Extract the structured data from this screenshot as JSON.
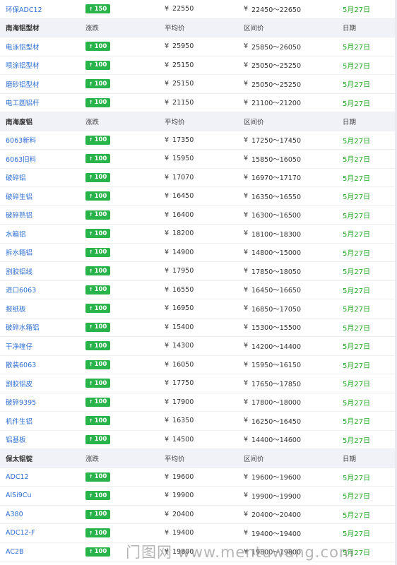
{
  "currency": "¥",
  "up_arrow": "↑",
  "watermark": "门图网 www.mentuwang.com",
  "sections": [
    {
      "header": null,
      "rows": [
        {
          "name": "环保ADC12",
          "change": "150",
          "avg": "22550",
          "range": "22450～22650",
          "date": "5月27日"
        }
      ]
    },
    {
      "header": {
        "name": "南海铝型材",
        "change": "涨跌",
        "avg": "平均价",
        "range": "区间价",
        "date": "日期"
      },
      "rows": [
        {
          "name": "电泳铝型材",
          "change": "100",
          "avg": "25950",
          "range": "25850～26050",
          "date": "5月27日"
        },
        {
          "name": "喷涂铝型材",
          "change": "100",
          "avg": "25150",
          "range": "25050～25250",
          "date": "5月27日"
        },
        {
          "name": "磨砂铝型材",
          "change": "100",
          "avg": "25150",
          "range": "25050～25250",
          "date": "5月27日"
        },
        {
          "name": "电工圆铝杆",
          "change": "100",
          "avg": "21150",
          "range": "21100～21200",
          "date": "5月27日"
        }
      ]
    },
    {
      "header": {
        "name": "南海废铝",
        "change": "涨跌",
        "avg": "平均价",
        "range": "区间价",
        "date": "日期"
      },
      "rows": [
        {
          "name": "6063新料",
          "change": "100",
          "avg": "17350",
          "range": "17250～17450",
          "date": "5月27日"
        },
        {
          "name": "6063旧料",
          "change": "100",
          "avg": "15950",
          "range": "15850～16050",
          "date": "5月27日"
        },
        {
          "name": "破碎铝",
          "change": "100",
          "avg": "17070",
          "range": "16970～17170",
          "date": "5月27日"
        },
        {
          "name": "破碎生铝",
          "change": "100",
          "avg": "16450",
          "range": "16350～16550",
          "date": "5月27日"
        },
        {
          "name": "破碎熟铝",
          "change": "100",
          "avg": "16400",
          "range": "16300～16500",
          "date": "5月27日"
        },
        {
          "name": "水箱铝",
          "change": "100",
          "avg": "18200",
          "range": "18100～18300",
          "date": "5月27日"
        },
        {
          "name": "拆水箱铝",
          "change": "100",
          "avg": "14900",
          "range": "14800～15000",
          "date": "5月27日"
        },
        {
          "name": "割胶铝线",
          "change": "100",
          "avg": "17950",
          "range": "17850～18050",
          "date": "5月27日"
        },
        {
          "name": "进口6063",
          "change": "100",
          "avg": "16550",
          "range": "16450～16650",
          "date": "5月27日"
        },
        {
          "name": "报纸板",
          "change": "100",
          "avg": "16950",
          "range": "16850～17050",
          "date": "5月27日"
        },
        {
          "name": "破碎水箱铝",
          "change": "100",
          "avg": "15400",
          "range": "15300～15500",
          "date": "5月27日"
        },
        {
          "name": "干净喹仔",
          "change": "100",
          "avg": "14300",
          "range": "14200～14400",
          "date": "5月27日"
        },
        {
          "name": "散装6063",
          "change": "100",
          "avg": "16050",
          "range": "15950～16150",
          "date": "5月27日"
        },
        {
          "name": "割胶铝皮",
          "change": "100",
          "avg": "17750",
          "range": "17650～17850",
          "date": "5月27日"
        },
        {
          "name": "破碎9395",
          "change": "100",
          "avg": "17900",
          "range": "17800～18000",
          "date": "5月27日"
        },
        {
          "name": "机件生铝",
          "change": "100",
          "avg": "16350",
          "range": "16250～16450",
          "date": "5月27日"
        },
        {
          "name": "铝基板",
          "change": "100",
          "avg": "14500",
          "range": "14400～14600",
          "date": "5月27日"
        }
      ]
    },
    {
      "header": {
        "name": "保太铝锭",
        "change": "涨跌",
        "avg": "平均价",
        "range": "区间价",
        "date": "日期"
      },
      "rows": [
        {
          "name": "ADC12",
          "change": "100",
          "avg": "19600",
          "range": "19600～19600",
          "date": "5月27日"
        },
        {
          "name": "AlSi9Cu",
          "change": "100",
          "avg": "19900",
          "range": "19900～19900",
          "date": "5月27日"
        },
        {
          "name": "A380",
          "change": "100",
          "avg": "20400",
          "range": "20400～20400",
          "date": "5月27日"
        },
        {
          "name": "ADC12-F",
          "change": "100",
          "avg": "19400",
          "range": "19400～19400",
          "date": "5月27日"
        },
        {
          "name": "AC2B",
          "change": "100",
          "avg": "19800",
          "range": "19800～19800",
          "date": "5月27日"
        }
      ]
    }
  ]
}
